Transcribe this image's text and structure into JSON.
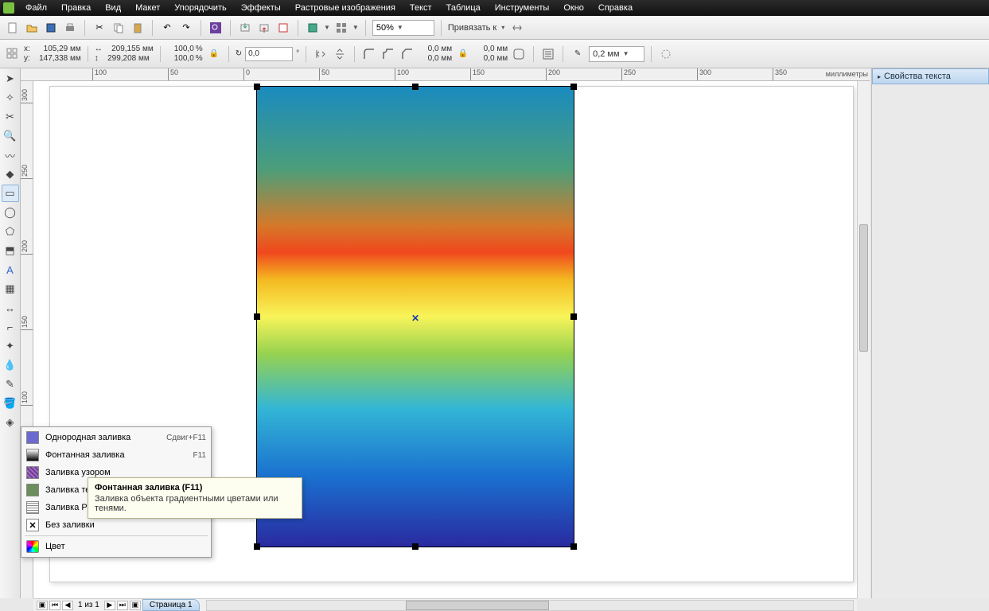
{
  "menu": [
    "Файл",
    "Правка",
    "Вид",
    "Макет",
    "Упорядочить",
    "Эффекты",
    "Растровые изображения",
    "Текст",
    "Таблица",
    "Инструменты",
    "Окно",
    "Справка"
  ],
  "toolbar1": {
    "zoom": "50%",
    "snap_label": "Привязать к"
  },
  "propbar": {
    "x_label": "x:",
    "y_label": "y:",
    "x": "105,29 мм",
    "y": "147,338 мм",
    "w_icon": "↔",
    "h_icon": "↕",
    "w": "209,155 мм",
    "h": "299,208 мм",
    "sx": "100,0",
    "sy": "100,0",
    "pct": "%",
    "rot_icon": "↻",
    "rot": "0,0",
    "deg": "°",
    "off1a": "0,0 мм",
    "off1b": "0,0 мм",
    "off2a": "0,0 мм",
    "off2b": "0,0 мм",
    "outline": "0,2 мм"
  },
  "ruler_units": "миллиметры",
  "hruler": [
    {
      "pos": 90,
      "label": "100"
    },
    {
      "pos": 185,
      "label": "50"
    },
    {
      "pos": 280,
      "label": "0"
    },
    {
      "pos": 375,
      "label": "50"
    },
    {
      "pos": 470,
      "label": "100"
    },
    {
      "pos": 565,
      "label": "150"
    },
    {
      "pos": 660,
      "label": "200"
    },
    {
      "pos": 755,
      "label": "250"
    },
    {
      "pos": 850,
      "label": "300"
    },
    {
      "pos": 945,
      "label": "350"
    }
  ],
  "vruler": [
    {
      "pos": 10,
      "label": "300"
    },
    {
      "pos": 105,
      "label": "250"
    },
    {
      "pos": 200,
      "label": "200"
    },
    {
      "pos": 295,
      "label": "150"
    },
    {
      "pos": 390,
      "label": "100"
    }
  ],
  "docker": {
    "title": "Свойства текста"
  },
  "pagebar": {
    "counter": "1 из 1",
    "tab": "Страница 1"
  },
  "flyout": {
    "items": [
      {
        "label": "Однородная заливка",
        "shortcut": "Сдвиг+F11",
        "icon": "solid"
      },
      {
        "label": "Фонтанная заливка",
        "shortcut": "F11",
        "icon": "gradient"
      },
      {
        "label": "Заливка узором",
        "shortcut": "",
        "icon": "pattern"
      },
      {
        "label": "Заливка текстурой",
        "shortcut": "",
        "icon": "texture"
      },
      {
        "label": "Заливка PostScript",
        "shortcut": "",
        "icon": "ps"
      },
      {
        "label": "Без заливки",
        "shortcut": "",
        "icon": "none"
      }
    ],
    "color_label": "Цвет"
  },
  "tooltip": {
    "title": "Фонтанная заливка (F11)",
    "body": "Заливка объекта градиентными цветами или тенями."
  }
}
